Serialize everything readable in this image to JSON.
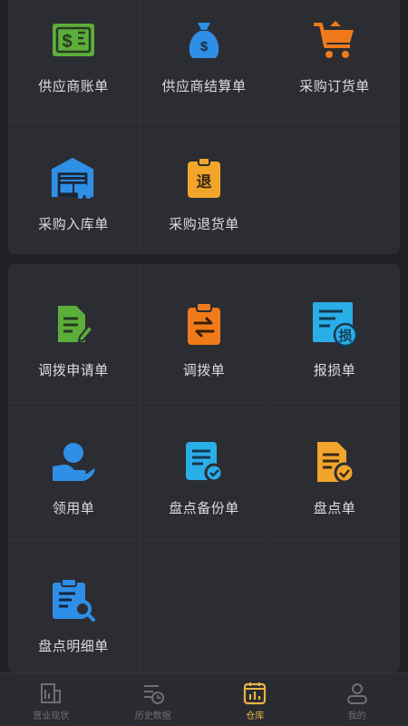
{
  "section1": {
    "items": [
      {
        "label": "供应商账单",
        "icon": "supplier-bill-icon"
      },
      {
        "label": "供应商结算单",
        "icon": "money-bag-icon"
      },
      {
        "label": "采购订货单",
        "icon": "shopping-cart-icon"
      },
      {
        "label": "采购入库单",
        "icon": "warehouse-truck-icon"
      },
      {
        "label": "采购退货单",
        "icon": "return-tag-icon"
      }
    ]
  },
  "section2": {
    "items": [
      {
        "label": "调拨申请单",
        "icon": "document-edit-icon"
      },
      {
        "label": "调拨单",
        "icon": "transfer-clipboard-icon"
      },
      {
        "label": "报损单",
        "icon": "loss-report-icon"
      },
      {
        "label": "领用单",
        "icon": "hand-user-icon"
      },
      {
        "label": "盘点备份单",
        "icon": "document-check-icon"
      },
      {
        "label": "盘点单",
        "icon": "inventory-check-icon"
      },
      {
        "label": "盘点明细单",
        "icon": "clipboard-search-icon"
      }
    ],
    "loss_glyph": "损",
    "return_glyph": "退",
    "money_glyph": "$"
  },
  "tabbar": {
    "tabs": [
      {
        "label": "营业现状",
        "icon": "building-chart-icon",
        "active": false
      },
      {
        "label": "历史数据",
        "icon": "history-list-icon",
        "active": false
      },
      {
        "label": "仓库",
        "icon": "warehouse-chart-icon",
        "active": true
      },
      {
        "label": "我的",
        "icon": "user-icon",
        "active": false
      }
    ]
  },
  "colors": {
    "green": "#5cae3a",
    "blue": "#2f8fe6",
    "orange": "#f07a1a",
    "amber": "#f2a52b",
    "cyan": "#2aaee8",
    "active_tab": "#e6b34a"
  }
}
